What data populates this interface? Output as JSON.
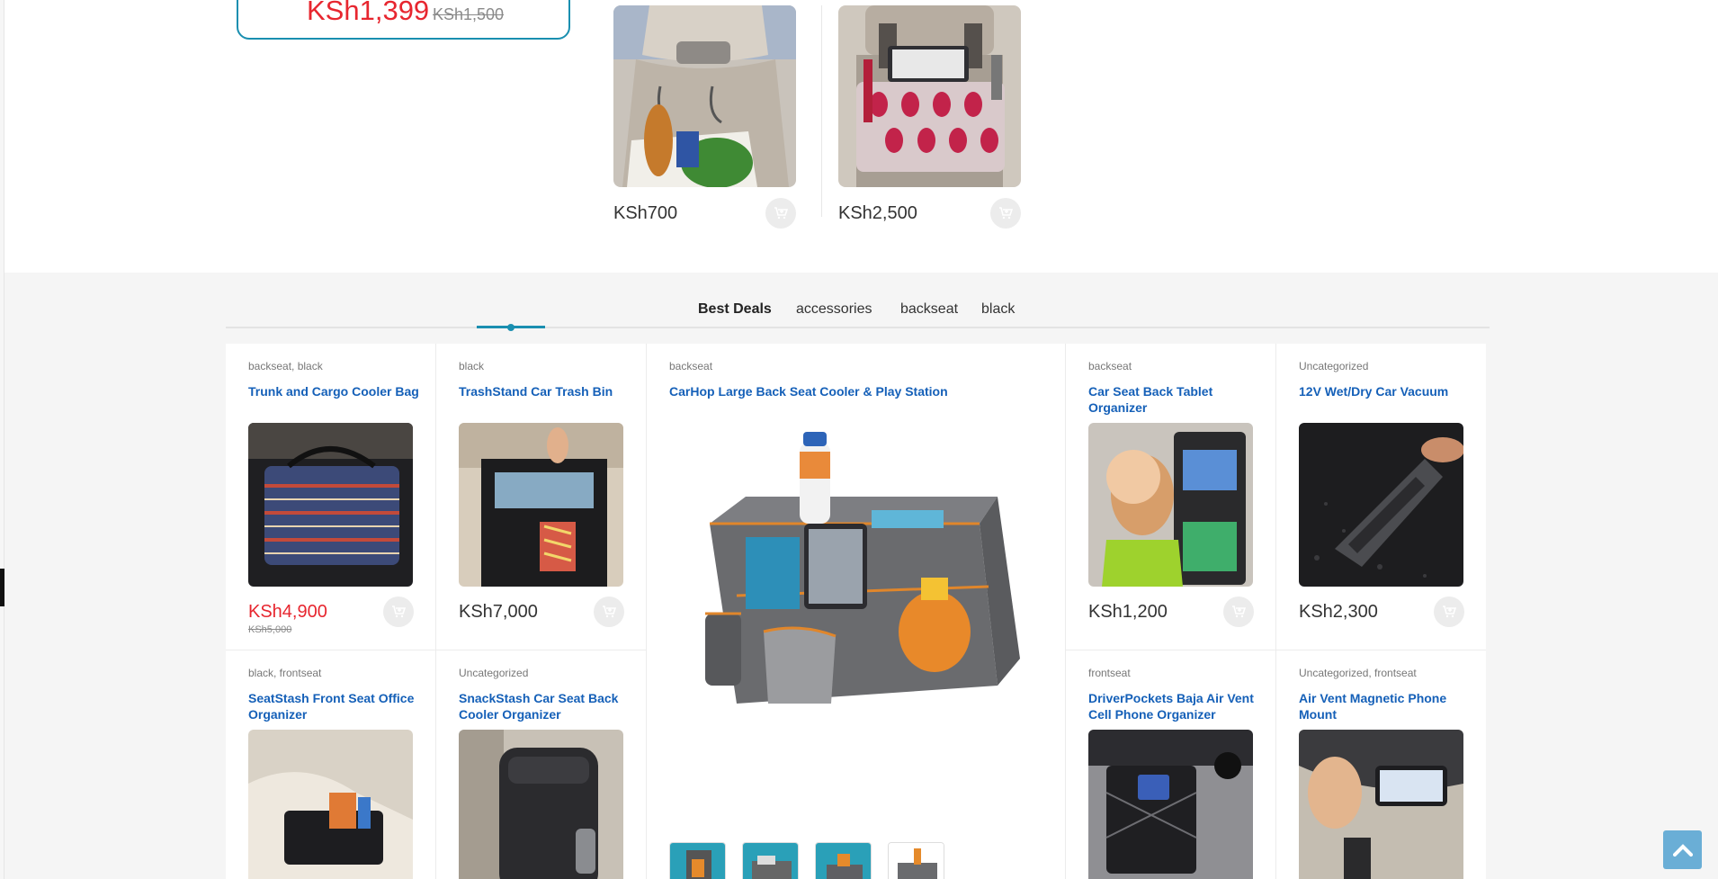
{
  "deal": {
    "price_sale": "KSh1,399",
    "price_old": "KSh1,500"
  },
  "top_products": [
    {
      "name": "backseat-hook-product",
      "price": "KSh700"
    },
    {
      "name": "backseat-organizer-product",
      "price": "KSh2,500"
    }
  ],
  "tabs": [
    {
      "label": "Best Deals",
      "active": true
    },
    {
      "label": "accessories",
      "active": false
    },
    {
      "label": "backseat",
      "active": false
    },
    {
      "label": "black",
      "active": false
    }
  ],
  "products": [
    {
      "category": "backseat, black",
      "title": "Trunk and Cargo Cooler Bag",
      "price": "KSh4,900",
      "old_price": "KSh5,000"
    },
    {
      "category": "black",
      "title": "TrashStand Car Trash Bin",
      "price": "KSh7,000"
    },
    {
      "category": "backseat",
      "title": "CarHop Large Back Seat Cooler & Play Station"
    },
    {
      "category": "backseat",
      "title": "Car Seat Back Tablet Organizer",
      "price": "KSh1,200"
    },
    {
      "category": "Uncategorized",
      "title": "12V Wet/Dry Car Vacuum",
      "price": "KSh2,300"
    },
    {
      "category": "black, frontseat",
      "title": "SeatStash Front Seat Office Organizer"
    },
    {
      "category": "Uncategorized",
      "title": "SnackStash Car Seat Back Cooler Organizer"
    },
    {
      "category": "frontseat",
      "title": "DriverPockets Baja Air Vent Cell Phone Organizer"
    },
    {
      "category": "Uncategorized, frontseat",
      "title": "Air Vent Magnetic Phone Mount"
    }
  ],
  "colors": {
    "accent": "#1a8fb0",
    "sale": "#e7262f",
    "link": "#1560b8",
    "scroll_button": "#6aaed6"
  },
  "icons": {
    "cart": "cart-plus-icon",
    "scroll": "chevron-up-icon"
  }
}
